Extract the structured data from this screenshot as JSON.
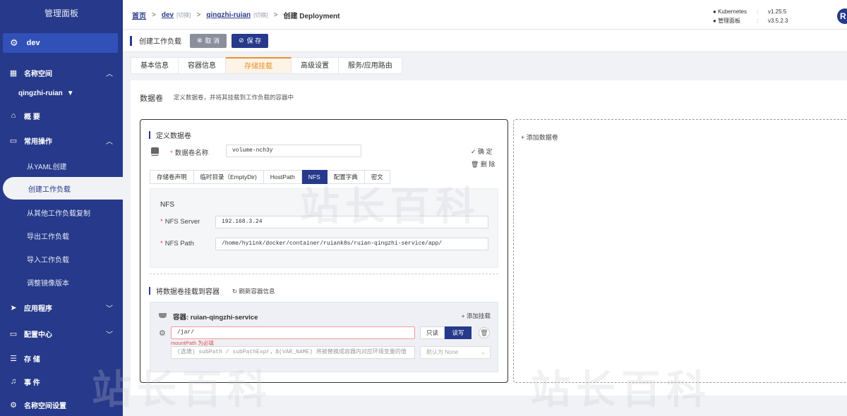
{
  "sidebar": {
    "title": "管理面板",
    "cluster": "dev",
    "namespace_group": "名称空间",
    "namespace": "qingzhi-ruian",
    "overview": "概 要",
    "common_ops": "常用操作",
    "sub_items": [
      "从YAML创建",
      "创建工作负载",
      "从其他工作负载复制",
      "导出工作负载",
      "导入工作负载",
      "调整镜像版本"
    ],
    "apps": "应用程序",
    "config": "配置中心",
    "storage": "存 储",
    "events": "事 件",
    "ns_settings": "名称空间设置"
  },
  "breadcrumb": {
    "home": "首页",
    "cluster": "dev",
    "cluster_tag": "[切换]",
    "namespace": "qingzhi-ruian",
    "namespace_tag": "[切换]",
    "current": "创建 Deployment"
  },
  "versions": {
    "k8s_label": "Kubernetes",
    "k8s_value": "v1.25.5",
    "panel_label": "管理面板",
    "panel_value": "v3.5.2.3",
    "colon": ":"
  },
  "corner_logo": "R",
  "actionbar": {
    "title": "创建工作负载",
    "cancel": "取 消",
    "save": "保 存"
  },
  "tabs": [
    "基本信息",
    "容器信息",
    "存储挂载",
    "高级设置",
    "服务/应用路由"
  ],
  "main": {
    "title": "数据卷",
    "desc": "定义数据卷，并将其挂载到工作负载的容器中",
    "define_title": "定义数据卷",
    "volume_name_label": "数据卷名称",
    "volume_name_value": "volume-nch3y",
    "confirm": "✓ 确 定",
    "delete": "🗑 删 除",
    "vol_types": [
      "存储卷声明",
      "临时目录（EmptyDir)",
      "HostPath",
      "NFS",
      "配置字典",
      "密文"
    ],
    "nfs_title": "NFS",
    "nfs_server_label": "NFS Server",
    "nfs_server_value": "192.168.3.24",
    "nfs_path_label": "NFS Path",
    "nfs_path_value": "/home/hy1ink/docker/container/ruiank8s/ruian-qingzhi-service/app/",
    "mount_title": "将数据卷挂载到容器",
    "refresh": "刷新容器信息",
    "container_label": "容器: ruian-qingzhi-service",
    "add_mount": "+ 添加挂载",
    "mount_path_value": "/jar/",
    "mount_path_error": "mountPath 为必填",
    "readonly": "只读",
    "readwrite": "读写",
    "subpath_placeholder": "(选填) subPath / subPathExpr，$(VAR_NAME) 将被替换成容器内对应环境变量的值",
    "subpath_select": "默认为 None",
    "add_volume": "+ 添加数据卷"
  },
  "colors": {
    "primary": "#26398a",
    "active_tab": "#e8922c",
    "error": "#e34d4d"
  }
}
